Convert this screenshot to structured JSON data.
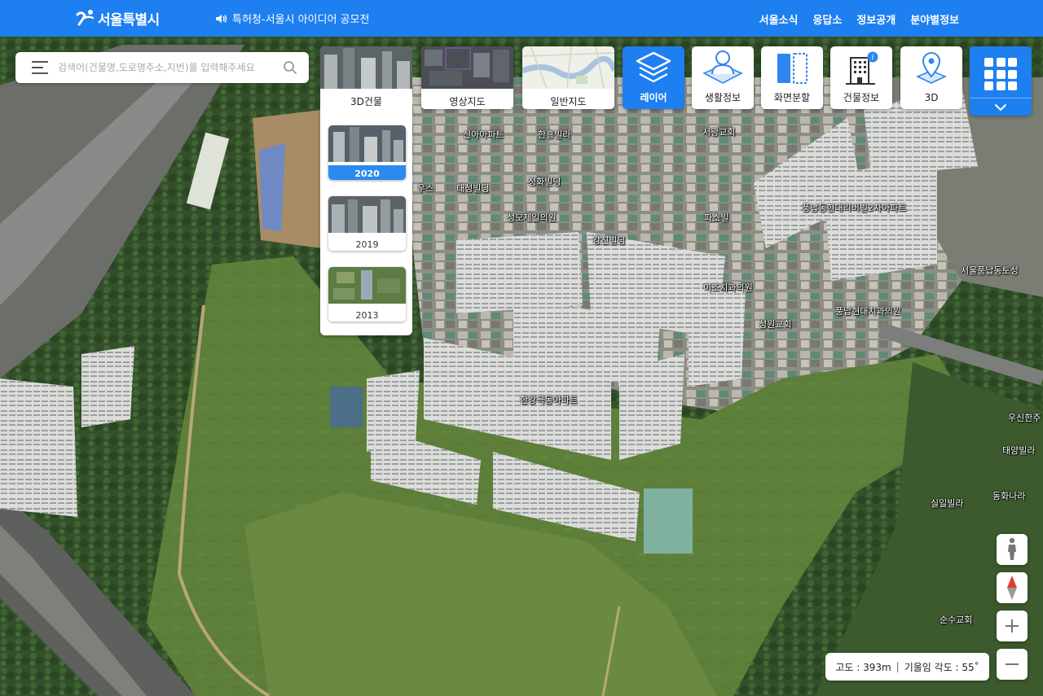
{
  "header": {
    "logo_text": "서울특별시",
    "notice": "특허청-서울시 아이디어 공모전",
    "nav": [
      "서울소식",
      "응답소",
      "정보공개",
      "분야별정보"
    ]
  },
  "search": {
    "placeholder": "검색어(건물명,도로명주소,지번)를 입력해주세요"
  },
  "map_types": {
    "building3d": "3D건물",
    "imagery": "영상지도",
    "general": "일반지도"
  },
  "years": {
    "selected": "2020",
    "items": [
      "2020",
      "2019",
      "2013"
    ]
  },
  "tools": {
    "layer": "레이어",
    "life_info": "생활정보",
    "split_screen": "화면분할",
    "building_info": "건물정보",
    "view3d": "3D"
  },
  "status": {
    "altitude": "고도 : 393m",
    "separator": "|",
    "tilt": "기울임 각도 : 55˚"
  },
  "map_labels": [
    "신아아파트",
    "한흥빌라",
    "서광교회",
    "정화빌딩",
    "태성빌딩",
    "우스",
    "성모제일의원",
    "파소빌",
    "강진빌딩",
    "풍납동현대리버빌2차아파트",
    "서울풍납동토성",
    "이조치과의원",
    "풍납현대치과의원",
    "성원교회",
    "한강극동아파트",
    "우신한주",
    "태양빌라",
    "실일빌라",
    "동화나라",
    "순수교회"
  ],
  "colors": {
    "brand_blue": "#1e7ff0",
    "year_active": "#2a8af0"
  }
}
